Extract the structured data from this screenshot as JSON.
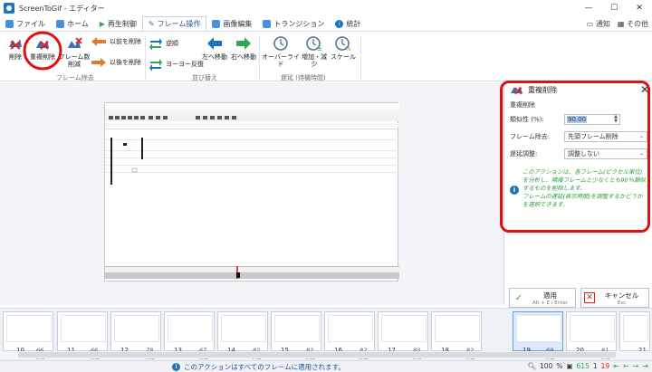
{
  "window": {
    "title": "ScreenToGif - エディター",
    "controls": {
      "minimize": "—",
      "maximize": "☐",
      "close": "✕"
    }
  },
  "tabs": [
    {
      "label": "ファイル",
      "icon": "file-icon",
      "color": "#4a90d9"
    },
    {
      "label": "ホーム",
      "icon": "home-icon",
      "color": "#4a90d9"
    },
    {
      "label": "再生制御",
      "icon": "play-icon",
      "color": "#2fa84f"
    },
    {
      "label": "フレーム操作",
      "icon": "frame-icon",
      "color": "#1e73be",
      "active": true
    },
    {
      "label": "画像編集",
      "icon": "image-icon",
      "color": "#4a90d9"
    },
    {
      "label": "トランジション",
      "icon": "transition-icon",
      "color": "#4a90d9"
    },
    {
      "label": "統計",
      "icon": "info-icon",
      "color": "#1e73be"
    }
  ],
  "tabbar_right": {
    "notify": "通知",
    "others": "その他"
  },
  "ribbon": {
    "delete": "削除",
    "remove_duplicates": "重複削除",
    "reduce_frames": "フレーム数\n削減",
    "delete_before": "以前を削除",
    "delete_after": "以後を削除",
    "group_remove": "フレーム除去",
    "reverse": "逆順",
    "yoyo": "ヨーヨー反復",
    "move_left": "左へ移動",
    "move_right": "右へ移動",
    "group_reorder": "並び替え",
    "override": "オーバーライド",
    "increase_decrease": "増加・減少",
    "scale": "スケール",
    "group_delay": "遅延 (待機時間)"
  },
  "panel": {
    "title": "重複削除",
    "section": "重複削除",
    "similarity_label": "類似性 (%):",
    "similarity_value": "90.00",
    "removal_label": "フレーム除去:",
    "removal_value": "先頭フレーム削除",
    "delay_label": "遅延調整:",
    "delay_value": "調整しない",
    "info": "このアクションは、各フレーム(ピクセル単位)を分析し、隣接フレームと少なくとも90％類似するものを削除します。\nフレームの遅延(表示時間)を調整するかどうかを選択できます。",
    "apply": "適用",
    "apply_shortcut": "Alt + E / Enter",
    "cancel": "キャンセル",
    "cancel_shortcut": "Esc"
  },
  "frames": [
    {
      "num": "10",
      "ms": "66 ms"
    },
    {
      "num": "11",
      "ms": "66 ms"
    },
    {
      "num": "12",
      "ms": "78 ms"
    },
    {
      "num": "13",
      "ms": "67 ms"
    },
    {
      "num": "14",
      "ms": "82 ms"
    },
    {
      "num": "15",
      "ms": "82 ms"
    },
    {
      "num": "16",
      "ms": "82 ms"
    },
    {
      "num": "17",
      "ms": "83 ms"
    },
    {
      "num": "18",
      "ms": "82 ms"
    },
    {
      "num": "19",
      "ms": "69 ms",
      "selected": true
    },
    {
      "num": "20",
      "ms": "81 ms"
    },
    {
      "num": "21",
      "ms": ""
    }
  ],
  "status": {
    "message": "このアクションはすべてのフレームに適用されます。",
    "zoom": "100",
    "zoom_unit": "%",
    "total_frames": "615",
    "selected_count": "1",
    "current_frame": "19"
  }
}
